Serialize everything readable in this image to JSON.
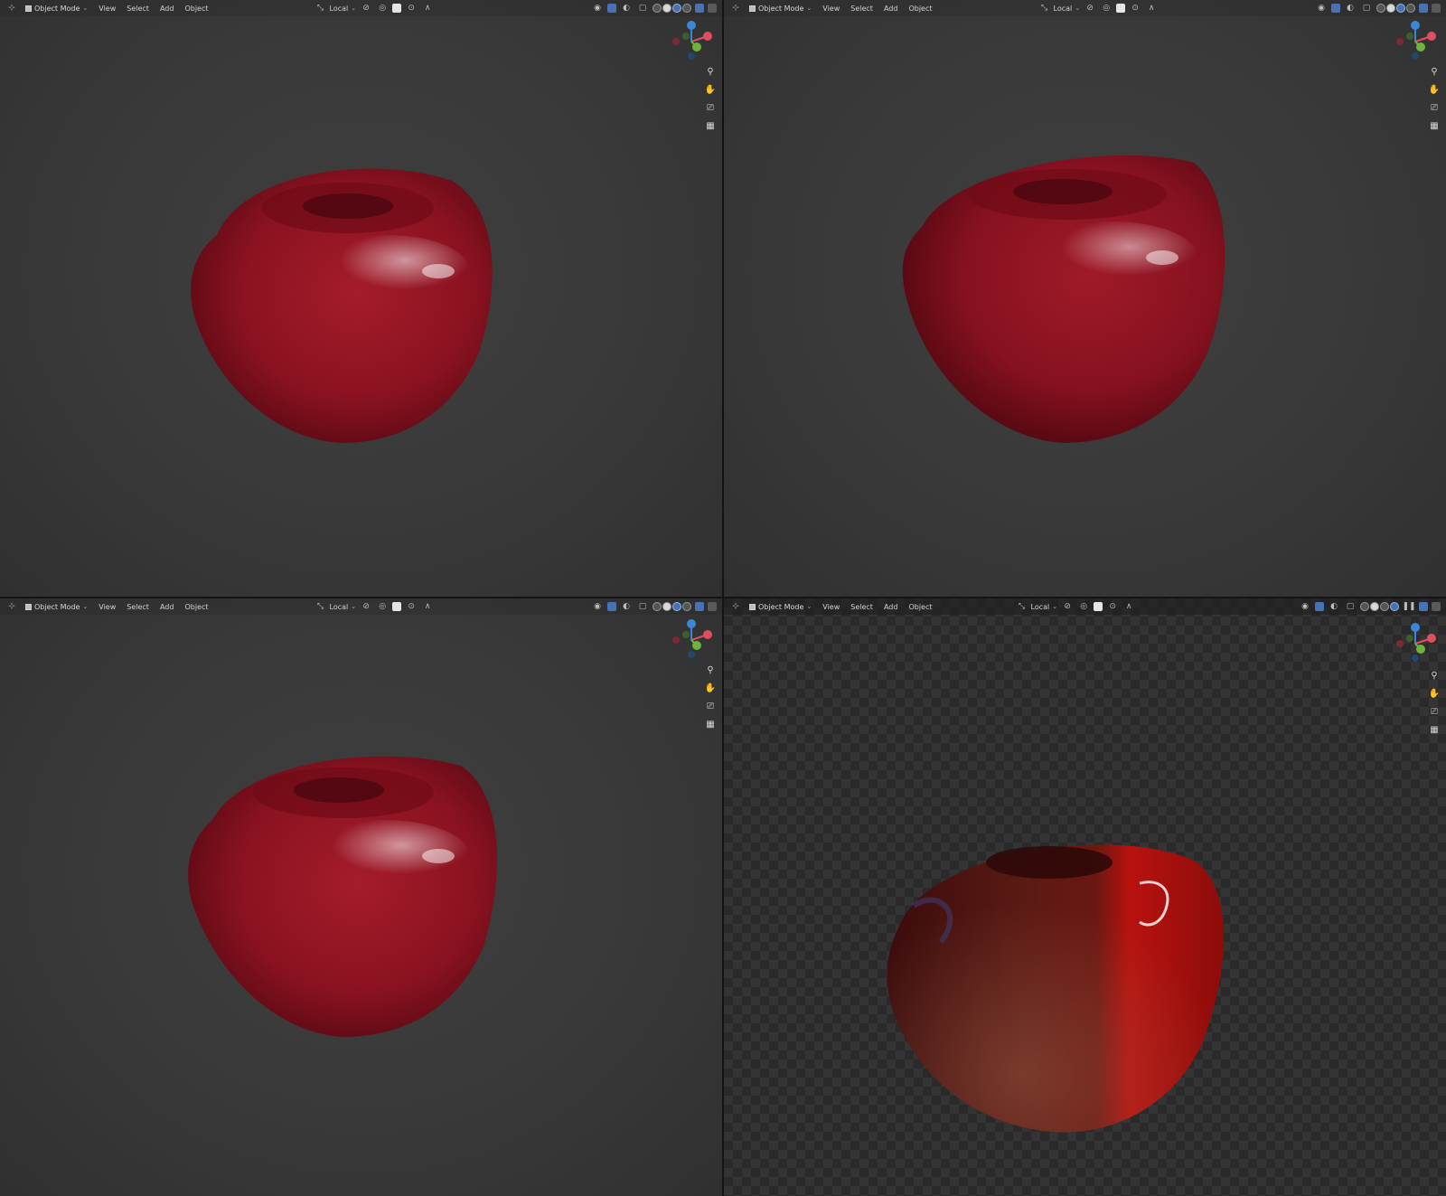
{
  "header": {
    "mode_label": "Object Mode",
    "menu": [
      "View",
      "Select",
      "Add",
      "Object"
    ],
    "pivot_label": "Local"
  },
  "icons": {
    "editor_type": "editor-type-icon",
    "transform_orientation": "transform-orientation-icon",
    "snap": "snap-icon",
    "proportional": "proportional-editing-icon",
    "visibility": "object-visibility-icon",
    "gizmo_toggle": "gizmo-toggle-icon",
    "overlay_toggle": "overlay-toggle-icon",
    "xray": "xray-icon",
    "shading_wireframe": "wireframe-shading-icon",
    "shading_solid": "solid-shading-icon",
    "shading_material": "material-preview-icon",
    "shading_rendered": "rendered-shading-icon",
    "zoom": "zoom-icon",
    "pan": "hand-pan-icon",
    "camera": "camera-view-icon",
    "ortho": "perspective-toggle-icon"
  },
  "gizmo_axes": {
    "x": "#e04f5f",
    "y": "#6fb43a",
    "z": "#3b86d6"
  },
  "viewports": [
    {
      "id": "top-left",
      "shading": "material",
      "background": "grey"
    },
    {
      "id": "top-right",
      "shading": "material",
      "background": "grey"
    },
    {
      "id": "bottom-left",
      "shading": "material",
      "background": "grey"
    },
    {
      "id": "bottom-right",
      "shading": "rendered",
      "background": "transparent-checker"
    }
  ],
  "colors": {
    "apple_dark": "#5a0a12",
    "apple_mid": "#8e1522",
    "apple_light": "#b22a36",
    "accent": "#4772b3"
  }
}
